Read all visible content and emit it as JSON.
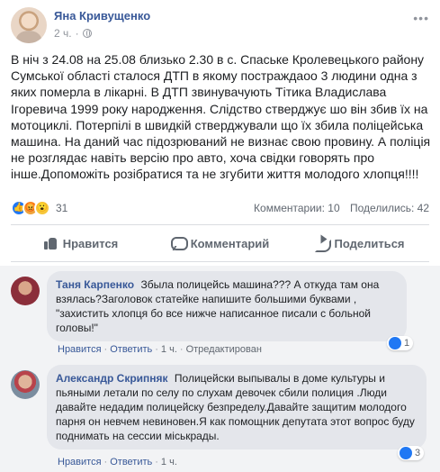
{
  "post": {
    "author": "Яна Кривущенко",
    "time": "2 ч.",
    "text": "В ніч з 24.08 на 25.08 близько 2.30 в с. Спаське Кролевецького району Сумської області сталося ДТП в якому постраждаоо 3 людини одна з яких померла в лікарні. В ДТП звинувачують Тітика Владислава Ігоревича 1999 року народження. Слідство стверджує шо він збив їх на мотоциклі. Потерпілі в швидкій стверджували що їх збила поліцейська машина. На даний час підозрюваний не визнає свою провину. А поліція не розглядає навіть версію про авто, хоча свідки говорять про інше.Допоможіть розібратися та не згубити життя молодого хлопця!!!!",
    "reaction_count": "31",
    "comments_count": "Комментарии: 10",
    "shares_count": "Поделились: 42",
    "reaction_icons": [
      "like-icon",
      "angry-icon",
      "wow-icon"
    ]
  },
  "actions": {
    "like": "Нравится",
    "comment": "Комментарий",
    "share": "Поделиться"
  },
  "comments": [
    {
      "author": "Таня Карпенко",
      "text": "Збыла полицейсь машина??? А откуда там она взялась?Заголовок статейке напишите большими буквами , \"захистить хлопця бо все нижче написанное писали с больной головы!\"",
      "like_label": "Нравится",
      "reply_label": "Ответить",
      "time": "1 ч.",
      "edited": "Отредактирован",
      "likes": "1"
    },
    {
      "author": "Александр Скрипняк",
      "text": "Полицейски выпывалы в доме культуры и пьяными летали по селу по слухам девочек сбили полиция .Люди давайте недадим полицейску безпределу.Давайте защитим молодого парня он невчем невиновен.Я как помощник депутата этот вопрос буду поднимать на сессии мiськрады.",
      "like_label": "Нравится",
      "reply_label": "Ответить",
      "time": "1 ч.",
      "likes": "3"
    }
  ],
  "colors": {
    "link": "#385898",
    "muted": "#606770",
    "like_blue": "#2078f4",
    "comment_bg": "#f2f3f5",
    "bubble_bg": "#e4e6eb"
  }
}
